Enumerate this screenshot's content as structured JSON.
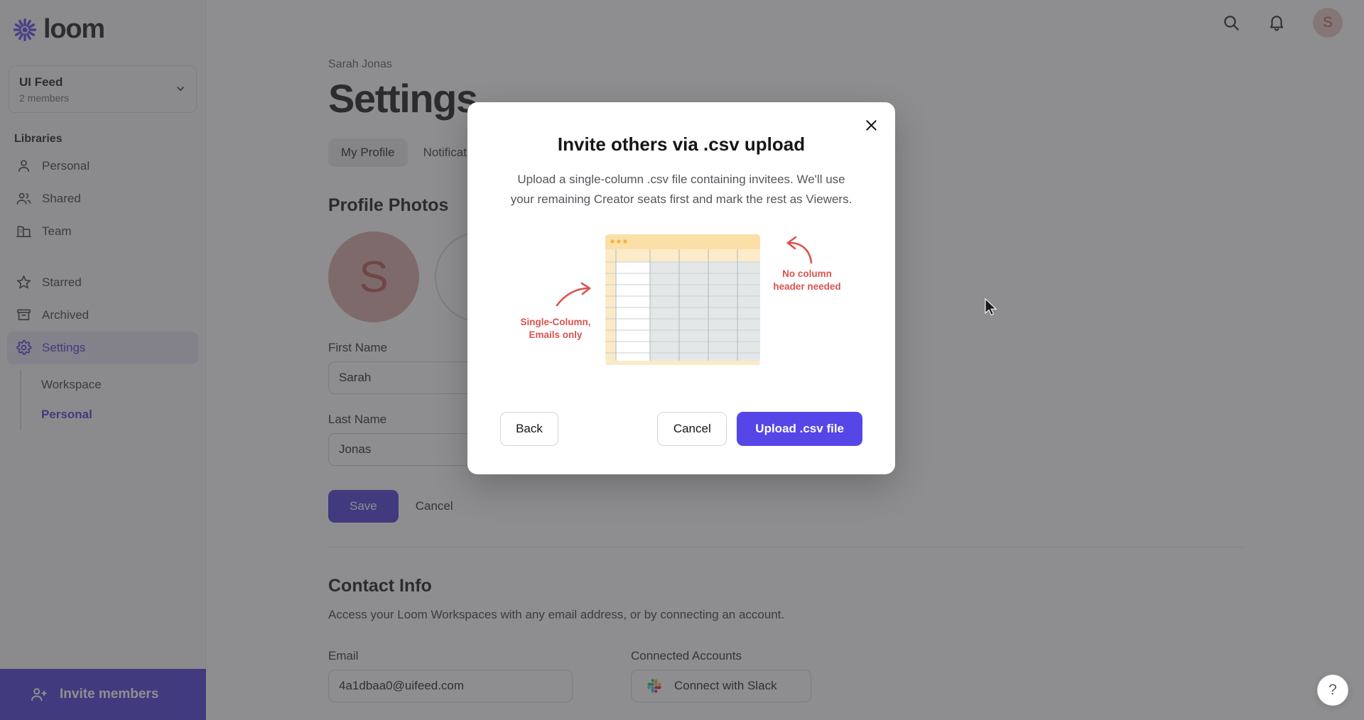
{
  "brand": {
    "name": "loom",
    "accent": "#4b38d3",
    "primary_button": "#5646e8",
    "annotation_red": "#d9534f"
  },
  "sidebar": {
    "workspace": {
      "name": "UI Feed",
      "members": "2 members",
      "chevron_icon": "chevron-down-icon"
    },
    "section_title": "Libraries",
    "items": [
      {
        "label": "Personal",
        "icon": "user-icon",
        "active": false
      },
      {
        "label": "Shared",
        "icon": "users-icon",
        "active": false
      },
      {
        "label": "Team",
        "icon": "building-icon",
        "active": false
      },
      {
        "label": "Starred",
        "icon": "star-icon",
        "active": false
      },
      {
        "label": "Archived",
        "icon": "archive-icon",
        "active": false
      },
      {
        "label": "Settings",
        "icon": "gear-icon",
        "active": true
      }
    ],
    "subitems": [
      {
        "label": "Workspace",
        "active": false
      },
      {
        "label": "Personal",
        "active": true
      }
    ],
    "invite_members": {
      "label": "Invite members",
      "icon": "add-people-icon"
    }
  },
  "topbar": {
    "search_icon": "search-icon",
    "notifications_icon": "bell-icon",
    "avatar_initial": "S"
  },
  "main": {
    "breadcrumb": "Sarah Jonas",
    "page_title": "Settings",
    "tabs": [
      {
        "label": "My Profile",
        "active": true
      },
      {
        "label": "Notifications",
        "active": false
      }
    ],
    "profile_photos": {
      "heading": "Profile Photos",
      "avatar_initial": "S"
    },
    "first_name": {
      "label": "First Name",
      "value": "Sarah"
    },
    "last_name": {
      "label": "Last Name",
      "value": "Jonas"
    },
    "save_label": "Save",
    "cancel_label": "Cancel",
    "contact_info": {
      "heading": "Contact Info",
      "description": "Access your Loom Workspaces with any email address, or by connecting an account.",
      "email_label": "Email",
      "email_value": "4a1dbaa0@uifeed.com",
      "connected_label": "Connected Accounts",
      "slack_label": "Connect with Slack",
      "slack_icon": "slack-icon"
    }
  },
  "modal": {
    "close_icon": "close-icon",
    "title": "Invite others via .csv upload",
    "description": "Upload a single-column .csv file containing invitees. We'll use your remaining Creator seats first and mark the rest as Viewers.",
    "illustration": {
      "left_annotation_line1": "Single-Column,",
      "left_annotation_line2": "Emails only",
      "right_annotation_line1": "No column",
      "right_annotation_line2": "header needed",
      "left_arrow_icon": "curved-arrow-right-icon",
      "right_arrow_icon": "curved-arrow-left-icon",
      "window_dots": 3,
      "header_color": "#fadfa8",
      "body_color": "#fdf0d8",
      "grid_color": "#e2e6e6"
    },
    "back_label": "Back",
    "cancel_label": "Cancel",
    "upload_label": "Upload .csv file"
  },
  "help": {
    "label": "?",
    "icon": "help-icon"
  }
}
